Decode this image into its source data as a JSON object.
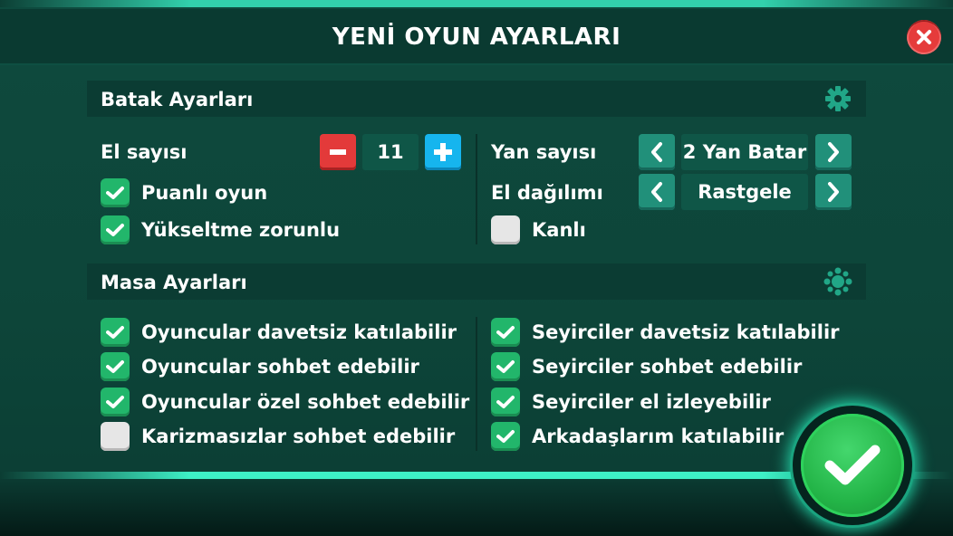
{
  "title": "YENİ OYUN AYARLARI",
  "batak": {
    "section_label": "Batak Ayarları",
    "icon": "gear-icon",
    "el_sayisi_label": "El sayısı",
    "el_sayisi_value": "11",
    "options_left": [
      {
        "label": "Puanlı oyun",
        "checked": true
      },
      {
        "label": "Yükseltme zorunlu",
        "checked": true
      }
    ],
    "yan_sayisi_label": "Yan sayısı",
    "yan_sayisi_value": "2 Yan Batar",
    "el_dagilimi_label": "El dağılımı",
    "el_dagilimi_value": "Rastgele",
    "kanli": {
      "label": "Kanlı",
      "checked": false
    }
  },
  "masa": {
    "section_label": "Masa Ayarları",
    "icon": "table-players-icon",
    "options_left": [
      {
        "label": "Oyuncular davetsiz katılabilir",
        "checked": true
      },
      {
        "label": "Oyuncular sohbet edebilir",
        "checked": true
      },
      {
        "label": "Oyuncular özel sohbet edebilir",
        "checked": true
      },
      {
        "label": "Karizmasızlar sohbet edebilir",
        "checked": false
      }
    ],
    "options_right": [
      {
        "label": "Seyirciler davetsiz katılabilir",
        "checked": true
      },
      {
        "label": "Seyirciler sohbet edebilir",
        "checked": true
      },
      {
        "label": "Seyirciler el izleyebilir",
        "checked": true
      },
      {
        "label": "Arkadaşlarım katılabilir",
        "checked": true
      }
    ]
  },
  "colors": {
    "background": "#0e4a3e",
    "check_on": "#22b66b",
    "check_off": "#e6e6e6",
    "minus": "#e33a3a",
    "plus": "#16b5ee",
    "arrow": "#21907a",
    "close": "#e53b3b",
    "confirm": "#23b447"
  }
}
